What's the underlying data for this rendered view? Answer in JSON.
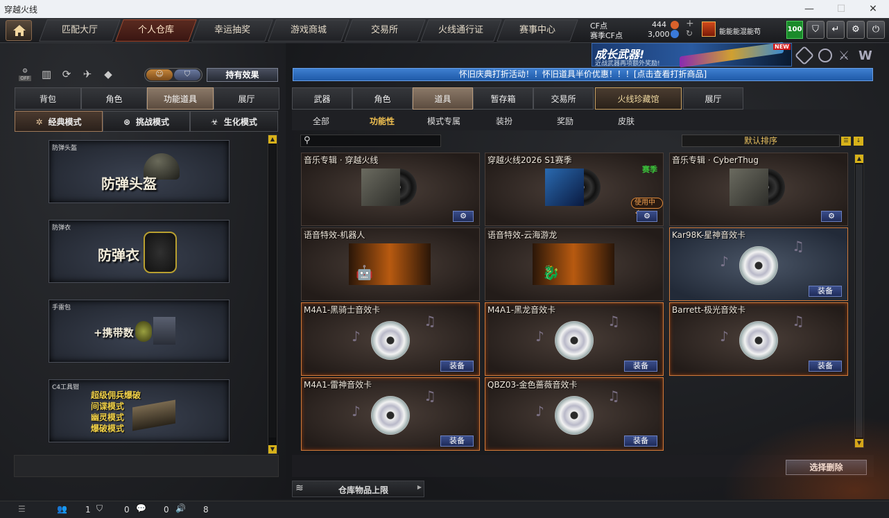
{
  "window": {
    "title": "穿越火线"
  },
  "nav": {
    "tabs": [
      "匹配大厅",
      "个人仓库",
      "幸运抽奖",
      "游戏商城",
      "交易所",
      "火线通行证",
      "赛事中心"
    ]
  },
  "currency": {
    "cf_label": "CF点",
    "cf_value": "444",
    "match_label": "赛季CF点",
    "match_value": "3,000",
    "level": "100",
    "player_name": "能能能混能苟"
  },
  "ad": {
    "title": "成长武器!",
    "subtitle": "近战武器再项额外奖励!",
    "badge": "NEW"
  },
  "left": {
    "toggle_button": "持有效果",
    "tabs": [
      "背包",
      "角色",
      "功能道具",
      "展厅"
    ],
    "modes": [
      "经典模式",
      "挑战模式",
      "生化模式"
    ],
    "slots": [
      {
        "caption": "防弹头盔",
        "label": "防弹头盔"
      },
      {
        "caption": "防弹衣",
        "label": "防弹衣"
      },
      {
        "caption": "手雷包",
        "label": "+携带数"
      },
      {
        "caption": "C4工具钳",
        "lines": [
          "超级佣兵爆破",
          "间谍模式",
          "幽灵模式",
          "爆破模式"
        ]
      }
    ]
  },
  "right": {
    "banner": "怀旧庆典打折活动！！怀旧道具半价优惠！！！[点击查看打折商品]",
    "tabs": [
      "武器",
      "角色",
      "道具",
      "暂存箱",
      "交易所",
      "火线珍藏馆",
      "展厅"
    ],
    "subtabs": [
      "全部",
      "功能性",
      "模式专属",
      "装扮",
      "奖励",
      "皮肤"
    ],
    "sort": "默认排序",
    "search_placeholder": "",
    "items": [
      {
        "name": "音乐专辑 · 穿越火线",
        "button": "⚙"
      },
      {
        "name": "穿越火线2026 S1赛季",
        "tag": "赛季",
        "badge": "使用中✓",
        "button": "⚙"
      },
      {
        "name": "音乐专辑 · CyberThug",
        "button": "⚙"
      },
      {
        "name": "语音特效-机器人"
      },
      {
        "name": "语音特效-云海游龙"
      },
      {
        "name": "Kar98K-星神音效卡",
        "button": "装备"
      },
      {
        "name": "M4A1-黑骑士音效卡",
        "button": "装备"
      },
      {
        "name": "M4A1-黑龙音效卡",
        "button": "装备"
      },
      {
        "name": "Barrett-极光音效卡",
        "button": "装备"
      },
      {
        "name": "M4A1-雷神音效卡",
        "button": "装备"
      },
      {
        "name": "QBZ03-金色蔷薇音效卡",
        "button": "装备"
      }
    ],
    "select_delete": "选择删除",
    "storage_limit": "仓库物品上限"
  },
  "status": {
    "friends": "1",
    "shield": "0",
    "chat": "0",
    "volume": "8"
  }
}
